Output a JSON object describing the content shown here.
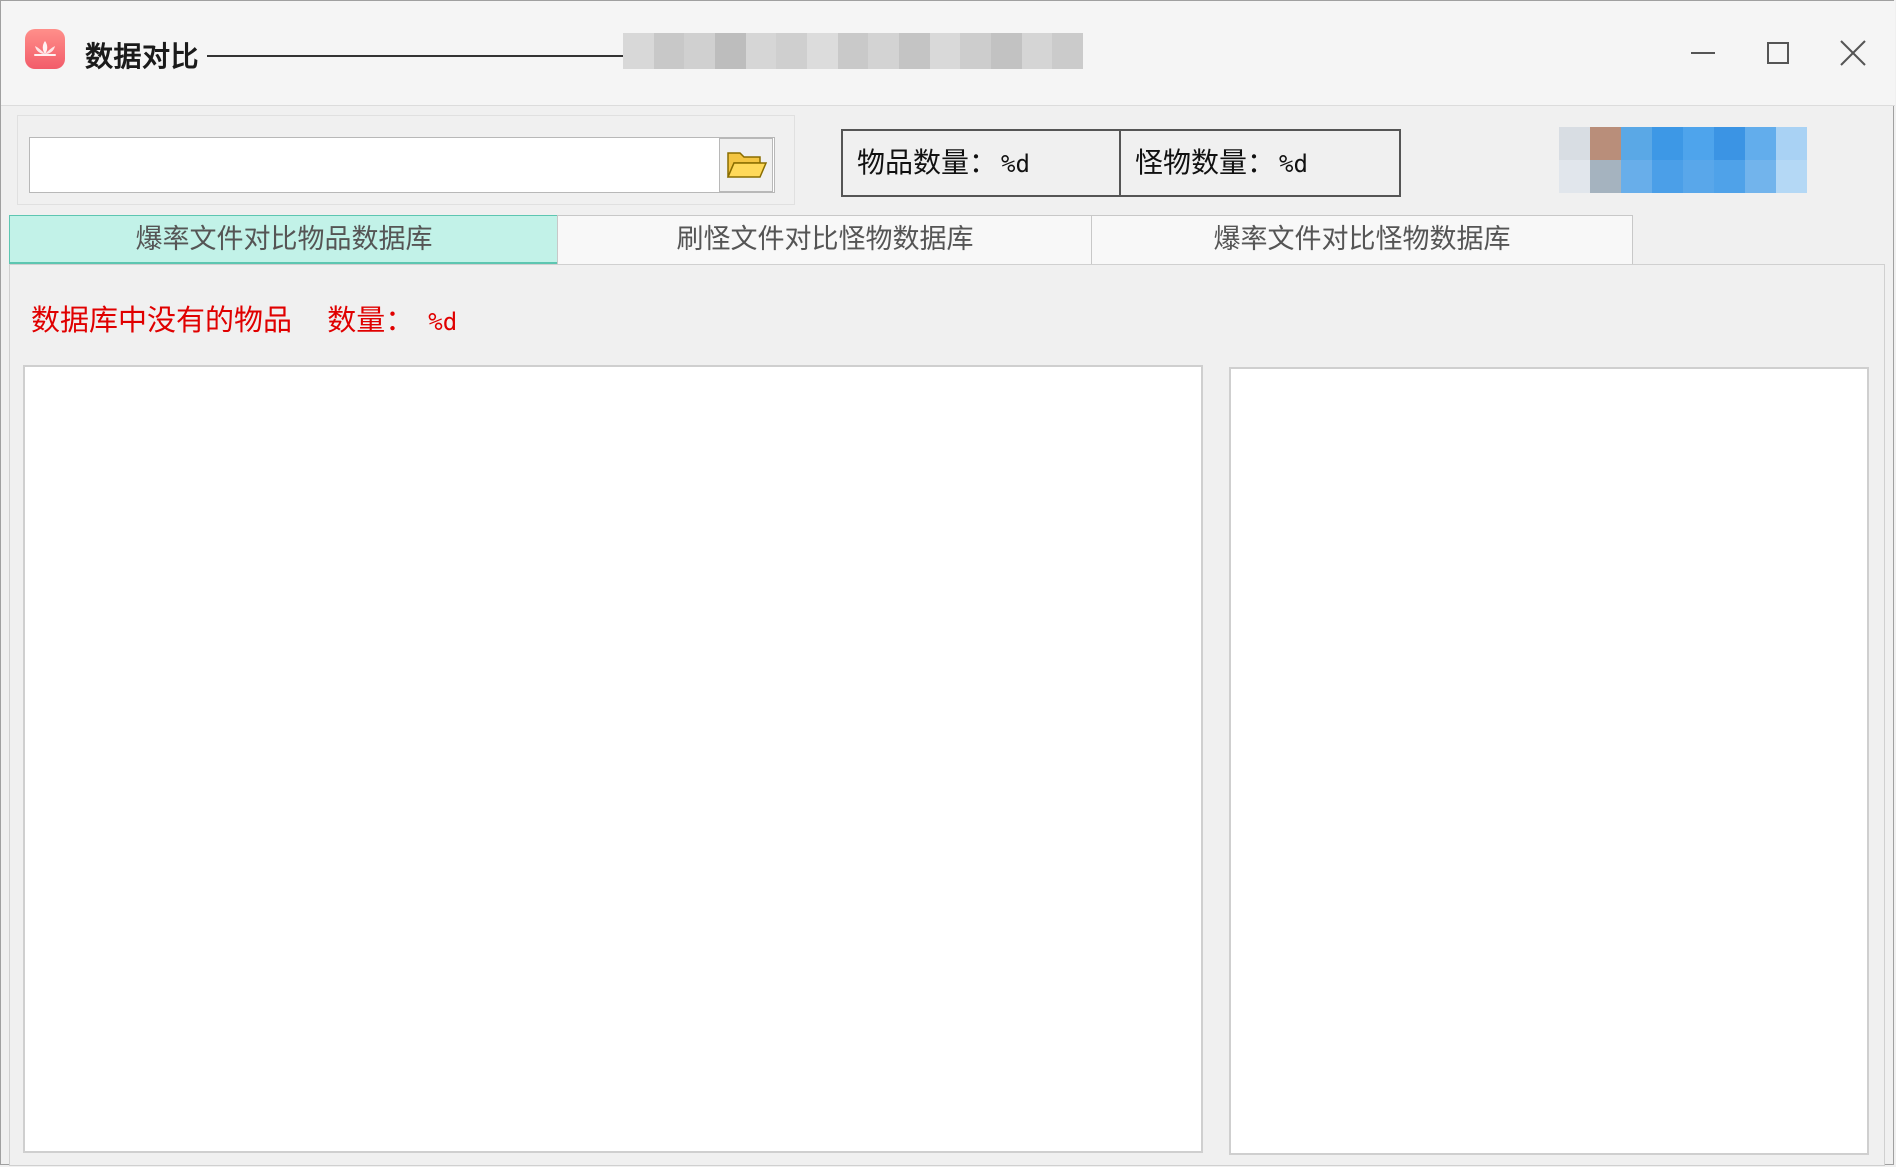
{
  "window": {
    "title": "数据对比",
    "icon": "lotus-app-icon",
    "controls": {
      "minimize": "minimize-icon",
      "maximize": "maximize-icon",
      "close": "close-icon"
    }
  },
  "file_picker": {
    "path_value": "",
    "browse_icon": "folder-open-icon"
  },
  "counters": {
    "items_label": "物品数量：",
    "items_value": "%d",
    "monsters_label": "怪物数量：",
    "monsters_value": "%d"
  },
  "tabs": [
    {
      "label": "爆率文件对比物品数据库",
      "active": true
    },
    {
      "label": "刷怪文件对比怪物数据库",
      "active": false
    },
    {
      "label": "爆率文件对比怪物数据库",
      "active": false
    }
  ],
  "panel": {
    "missing_label": "数据库中没有的物品",
    "count_label": "数量：",
    "count_value": "%d"
  },
  "colors": {
    "active_tab_bg": "#c2f2e8",
    "active_tab_border": "#5dc6b1",
    "warning_text": "#e00000",
    "app_icon": "#f25c6a"
  }
}
